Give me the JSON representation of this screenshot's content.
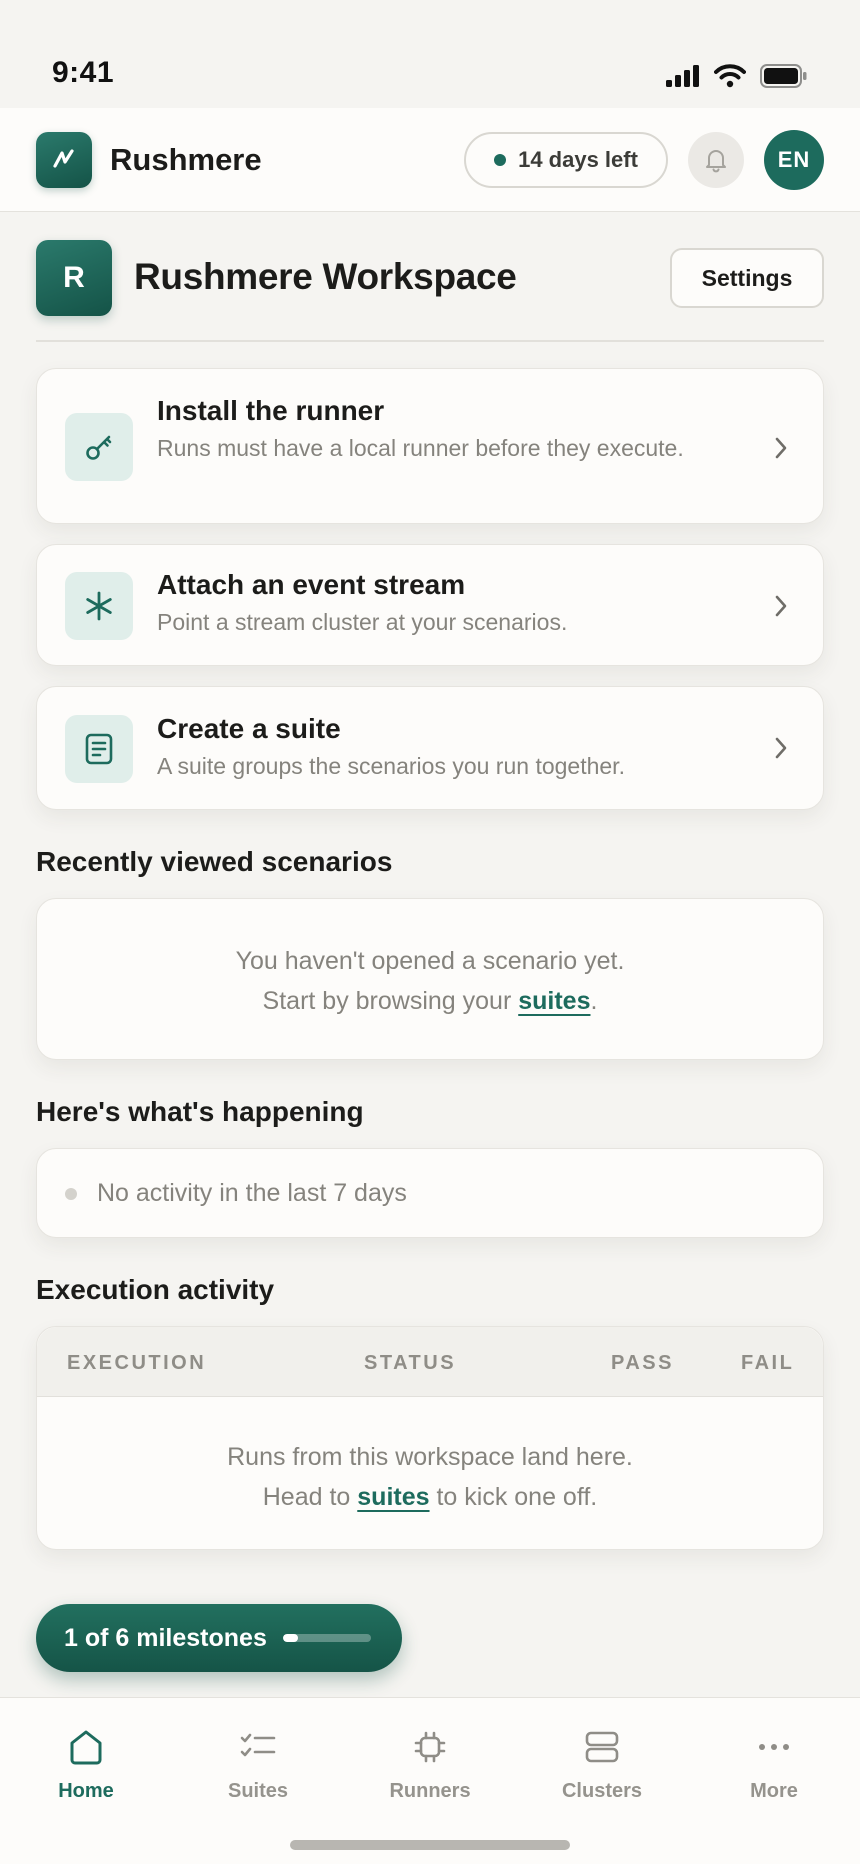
{
  "status_bar": {
    "time": "9:41"
  },
  "header": {
    "brand": "Rushmere",
    "trial_label": "14 days left",
    "avatar_initials": "EN"
  },
  "workspace": {
    "badge": "R",
    "title": "Rushmere Workspace",
    "settings_label": "Settings"
  },
  "tasks": [
    {
      "title": "Install the runner",
      "description": "Runs must have a local runner before they execute.",
      "icon": "key-icon"
    },
    {
      "title": "Attach an event stream",
      "description": "Point a stream cluster at your scenarios.",
      "icon": "asterisk-icon"
    },
    {
      "title": "Create a suite",
      "description": "A suite groups the scenarios you run together.",
      "icon": "document-icon"
    }
  ],
  "recent": {
    "title": "Recently viewed scenarios",
    "line1": "You haven't opened a scenario yet.",
    "line2_prefix": "Start by browsing your ",
    "line2_link": "suites",
    "line2_suffix": "."
  },
  "happening": {
    "title": "Here's what's happening",
    "text": "No activity in the last 7 days"
  },
  "executions": {
    "title": "Execution activity",
    "columns": [
      "EXECUTION",
      "STATUS",
      "PASS",
      "FAIL"
    ],
    "empty_line1": "Runs from this workspace land here.",
    "empty_line2_prefix": "Head to ",
    "empty_line2_link": "suites",
    "empty_line2_suffix": " to kick one off."
  },
  "milestones": {
    "label": "1 of 6 milestones",
    "completed": 1,
    "total": 6
  },
  "tabs": [
    {
      "label": "Home",
      "icon": "home-icon",
      "active": true
    },
    {
      "label": "Suites",
      "icon": "checklist-icon",
      "active": false
    },
    {
      "label": "Runners",
      "icon": "chip-icon",
      "active": false
    },
    {
      "label": "Clusters",
      "icon": "server-icon",
      "active": false
    },
    {
      "label": "More",
      "icon": "more-icon",
      "active": false
    }
  ],
  "colors": {
    "accent": "#1d6b5d",
    "background": "#f5f4f1",
    "card": "#fdfcfa",
    "muted_text": "#85837d"
  }
}
